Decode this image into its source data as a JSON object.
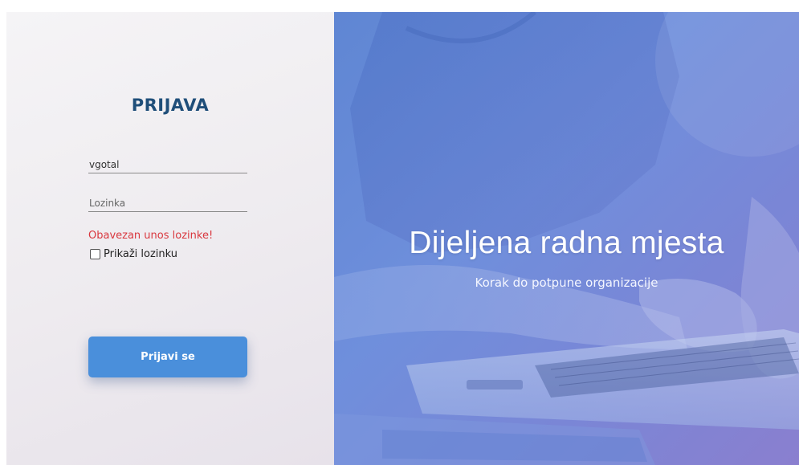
{
  "login": {
    "title": "PRIJAVA",
    "username_value": "vgotal",
    "password_placeholder": "Lozinka",
    "error_text": "Obavezan unos lozinke!",
    "show_password_label": "Prikaži lozinku",
    "submit_label": "Prijavi se"
  },
  "hero": {
    "title": "Dijeljena radna mjesta",
    "subtitle": "Korak do potpune organizacije"
  },
  "colors": {
    "title": "#1f4e79",
    "accent": "#4a8fdb",
    "error": "#d9383f"
  }
}
